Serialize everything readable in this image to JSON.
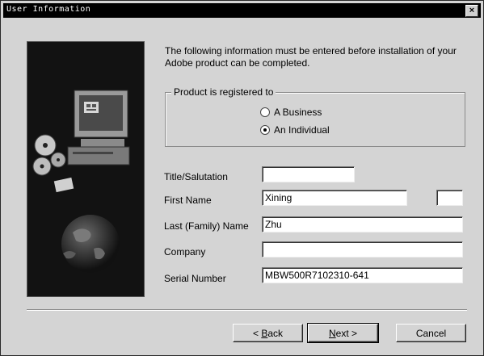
{
  "window": {
    "title": "User Information",
    "close_glyph": "×"
  },
  "intro_text": "The following information must be entered before installation of your Adobe product can be completed.",
  "registration": {
    "legend": "Product is registered to",
    "options": [
      {
        "label": "A Business",
        "checked": false
      },
      {
        "label": "An Individual",
        "checked": true
      }
    ]
  },
  "fields": {
    "title": {
      "label": "Title/Salutation",
      "value": ""
    },
    "first_name": {
      "label": "First Name",
      "value": "Xining",
      "initial_value": ""
    },
    "last_name": {
      "label": "Last (Family) Name",
      "value": "Zhu"
    },
    "company": {
      "label": "Company",
      "value": ""
    },
    "serial": {
      "label": "Serial Number",
      "value": "MBW500R7102310-641"
    }
  },
  "buttons": {
    "back": {
      "prefix": "< ",
      "accel": "B",
      "rest": "ack"
    },
    "next": {
      "accel": "N",
      "rest": "ext >"
    },
    "cancel": "Cancel"
  }
}
